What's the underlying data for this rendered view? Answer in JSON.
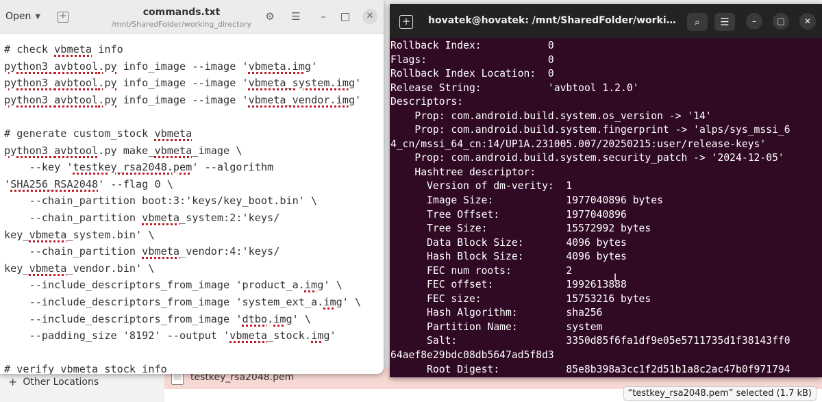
{
  "file_manager": {
    "sidebar_other_locations": "Other Locations",
    "selected_file": "testkey_rsa2048.pem",
    "status": "“testkey_rsa2048.pem” selected  (1.7 kB)"
  },
  "gedit": {
    "open_label": "Open",
    "title": "commands.txt",
    "subtitle": "/mnt/SharedFolder/working_directory",
    "lines": [
      [
        {
          "t": "# check "
        },
        {
          "t": "vbmeta",
          "s": 1
        },
        {
          "t": " info"
        }
      ],
      [
        {
          "t": "python3 ",
          "s": 1
        },
        {
          "t": "avbtool",
          "s": 1
        },
        {
          "t": ".py",
          "s": 1
        },
        {
          "t": " info_image --image '"
        },
        {
          "t": "vbmeta.img",
          "s": 1
        },
        {
          "t": "'"
        }
      ],
      [
        {
          "t": "python3 ",
          "s": 1
        },
        {
          "t": "avbtool",
          "s": 1
        },
        {
          "t": ".py",
          "s": 1
        },
        {
          "t": " info_image --image '"
        },
        {
          "t": "vbmeta_system.img",
          "s": 1
        },
        {
          "t": "'"
        }
      ],
      [
        {
          "t": "python3 ",
          "s": 1
        },
        {
          "t": "avbtool",
          "s": 1
        },
        {
          "t": ".py",
          "s": 1
        },
        {
          "t": " info_image --image '"
        },
        {
          "t": "vbmeta_vendor.img",
          "s": 1
        },
        {
          "t": "'"
        }
      ],
      [
        {
          "t": ""
        }
      ],
      [
        {
          "t": "# generate custom_stock "
        },
        {
          "t": "vbmeta",
          "s": 1
        }
      ],
      [
        {
          "t": "python3 ",
          "s": 1
        },
        {
          "t": "avbtool",
          "s": 1
        },
        {
          "t": ".py make_"
        },
        {
          "t": "vbmeta",
          "s": 1
        },
        {
          "t": "_image \\"
        }
      ],
      [
        {
          "t": "    --key '"
        },
        {
          "t": "testkey_rsa2048.pem",
          "s": 1
        },
        {
          "t": "' --algorithm"
        }
      ],
      [
        {
          "t": "'"
        },
        {
          "t": "SHA256_RSA2048",
          "s": 1
        },
        {
          "t": "' --flag 0 \\"
        }
      ],
      [
        {
          "t": "    --chain_partition boot:3:'keys/key_boot.bin' \\"
        }
      ],
      [
        {
          "t": "    --chain_partition "
        },
        {
          "t": "vbmeta",
          "s": 1
        },
        {
          "t": "_system:2:'keys/"
        }
      ],
      [
        {
          "t": "key_"
        },
        {
          "t": "vbmeta",
          "s": 1
        },
        {
          "t": "_system.bin' \\"
        }
      ],
      [
        {
          "t": "    --chain_partition "
        },
        {
          "t": "vbmeta",
          "s": 1
        },
        {
          "t": "_vendor:4:'keys/"
        }
      ],
      [
        {
          "t": "key_"
        },
        {
          "t": "vbmeta",
          "s": 1
        },
        {
          "t": "_vendor.bin' \\"
        }
      ],
      [
        {
          "t": "    --include_descriptors_from_image 'product_a."
        },
        {
          "t": "img",
          "s": 1
        },
        {
          "t": "' \\"
        }
      ],
      [
        {
          "t": "    --include_descriptors_from_image 'system_ext_a."
        },
        {
          "t": "img",
          "s": 1
        },
        {
          "t": "' \\"
        }
      ],
      [
        {
          "t": "    --include_descriptors_from_image '"
        },
        {
          "t": "dtbo",
          "s": 1
        },
        {
          "t": "."
        },
        {
          "t": "img",
          "s": 1
        },
        {
          "t": "' \\"
        }
      ],
      [
        {
          "t": "    --padding_size '8192' --output '"
        },
        {
          "t": "vbmeta",
          "s": 1
        },
        {
          "t": "_stock."
        },
        {
          "t": "img",
          "s": 1
        },
        {
          "t": "'"
        }
      ],
      [
        {
          "t": ""
        }
      ],
      [
        {
          "t": "# verify "
        },
        {
          "t": "vbmeta",
          "s": 1
        },
        {
          "t": "_stock info"
        }
      ]
    ]
  },
  "terminal": {
    "title": "hovatek@hovatek: /mnt/SharedFolder/working_direc...",
    "lines": [
      "Rollback Index:           0",
      "Flags:                    0",
      "Rollback Index Location:  0",
      "Release String:           'avbtool 1.2.0'",
      "Descriptors:",
      "    Prop: com.android.build.system.os_version -> '14'",
      "    Prop: com.android.build.system.fingerprint -> 'alps/sys_mssi_6",
      "4_cn/mssi_64_cn:14/UP1A.231005.007/20250215:user/release-keys'",
      "    Prop: com.android.build.system.security_patch -> '2024-12-05'",
      "    Hashtree descriptor:",
      "      Version of dm-verity:  1",
      "      Image Size:            1977040896 bytes",
      "      Tree Offset:           1977040896",
      "      Tree Size:             15572992 bytes",
      "      Data Block Size:       4096 bytes",
      "      Hash Block Size:       4096 bytes",
      "      FEC num roots:         2",
      "      FEC offset:            1992613888",
      "      FEC size:              15753216 bytes",
      "      Hash Algorithm:        sha256",
      "      Partition Name:        system",
      "      Salt:                  3350d85f6fa1df9e05e5711735d1f38143ff0",
      "64aef8e29bdc08db5647ad5f8d3",
      "      Root Digest:           85e8b398a3cc1f2d51b1a8c2ac47b0f971794"
    ]
  }
}
